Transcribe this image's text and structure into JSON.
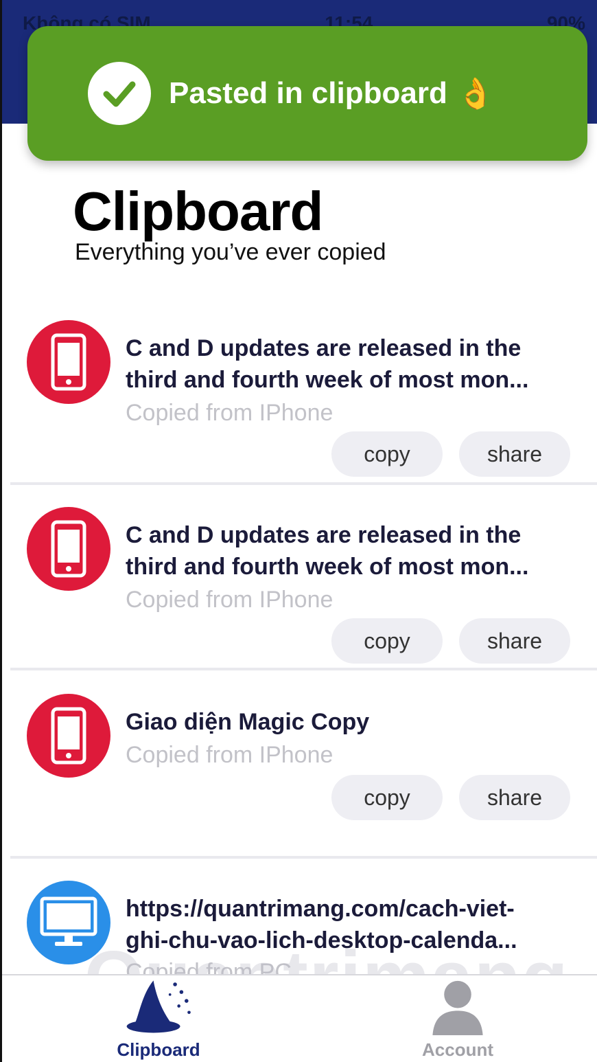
{
  "status_bar": {
    "carrier": "Không có SIM",
    "time": "11:54",
    "battery": "90%"
  },
  "toast": {
    "message": "Pasted in clipboard",
    "emoji": "👌",
    "color": "#5a9e24"
  },
  "page": {
    "title": "Clipboard",
    "subtitle": "Everything you’ve ever copied"
  },
  "items": [
    {
      "device": "phone",
      "text_line1": "C and D updates are released in the",
      "text_line2": "third and fourth week of most mon...",
      "source": "Copied from IPhone",
      "copy_label": "copy",
      "share_label": "share"
    },
    {
      "device": "phone",
      "text_line1": "C and D updates are released in the",
      "text_line2": "third and fourth week of most mon...",
      "source": "Copied from IPhone",
      "copy_label": "copy",
      "share_label": "share"
    },
    {
      "device": "phone",
      "text_line1": "Giao diện Magic Copy",
      "source": "Copied from IPhone",
      "copy_label": "copy",
      "share_label": "share"
    },
    {
      "device": "desktop",
      "text_line1": "https://quantrimang.com/cach-viet-",
      "text_line2": "ghi-chu-vao-lich-desktop-calenda...",
      "source": "Copied from PC"
    }
  ],
  "tabbar": {
    "clipboard_label": "Clipboard",
    "account_label": "Account"
  },
  "watermark": "Quantrimang",
  "colors": {
    "header": "#1a2a78",
    "phone_avatar": "#de1a3a",
    "pc_avatar": "#2a8fe8",
    "active_tab": "#1a2a78"
  }
}
